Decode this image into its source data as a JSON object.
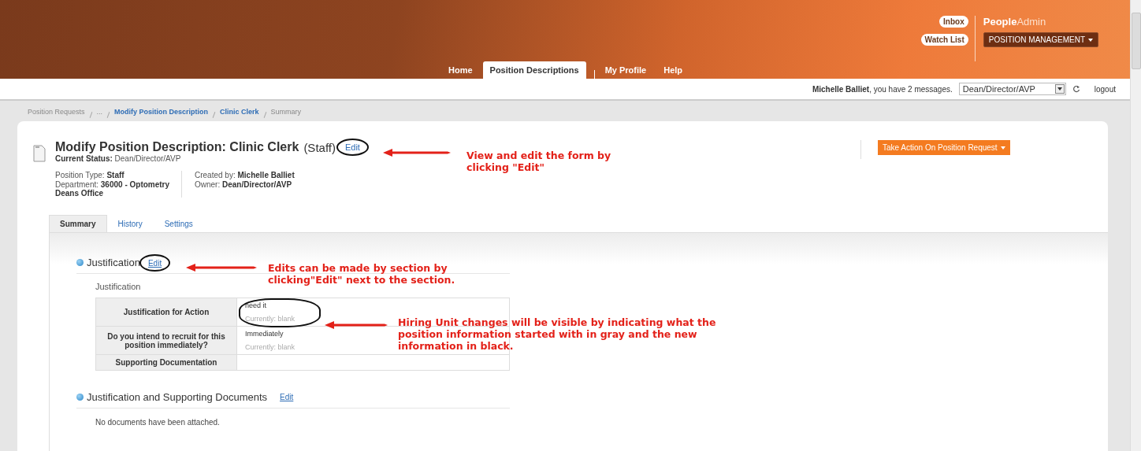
{
  "header": {
    "links": [
      "Inbox",
      "Watch List"
    ],
    "brand": {
      "bold": "People",
      "light": "Admin"
    },
    "module_menu": "POSITION MANAGEMENT",
    "nav": [
      {
        "label": "Home",
        "selected": false,
        "divider": false
      },
      {
        "label": "Position Descriptions",
        "selected": true,
        "divider": false
      },
      {
        "label": "My Profile",
        "selected": false,
        "divider": true
      },
      {
        "label": "Help",
        "selected": false,
        "divider": false
      }
    ]
  },
  "user_bar": {
    "user": "Michelle Balliet",
    "message": ", you have 2 messages.",
    "role": "Dean/Director/AVP",
    "logout": "logout"
  },
  "breadcrumb": [
    {
      "label": "Position Requests",
      "kind": "plain"
    },
    {
      "label": "...",
      "kind": "plain"
    },
    {
      "label": "Modify Position Description",
      "kind": "link"
    },
    {
      "label": "Clinic Clerk",
      "kind": "link"
    },
    {
      "label": "Summary",
      "kind": "plain"
    }
  ],
  "record": {
    "title": "Modify Position Description: Clinic Clerk",
    "type": "(Staff)",
    "edit": "Edit",
    "status_label": "Current Status:",
    "status": "Dean/Director/AVP",
    "meta_left": [
      {
        "label": "Position Type:",
        "value": "Staff"
      },
      {
        "label": "Department:",
        "value": "36000 - Optometry Deans Office"
      }
    ],
    "meta_right": [
      {
        "label": "Created by:",
        "value": "Michelle Balliet"
      },
      {
        "label": "Owner:",
        "value": "Dean/Director/AVP"
      }
    ],
    "action_button": "Take Action On Position Request"
  },
  "tabs": [
    {
      "label": "Summary",
      "selected": true
    },
    {
      "label": "History",
      "selected": false
    },
    {
      "label": "Settings",
      "selected": false
    }
  ],
  "sections": [
    {
      "title": "Justification",
      "edit": "Edit",
      "subtitle": "Justification",
      "rows": [
        {
          "label": "Justification for Action",
          "value": "need it",
          "current": "Currently: blank"
        },
        {
          "label": "Do you intend to recruit for this position immediately?",
          "value": "Immediately",
          "current": "Currently: blank"
        },
        {
          "label": "Supporting Documentation"
        }
      ]
    },
    {
      "title": "Justification and Supporting Documents",
      "edit": "Edit",
      "note": "No documents have been attached."
    }
  ],
  "annotations": [
    "View and edit the form by clicking \"Edit\"",
    "Edits can be made by section by clicking\"Edit\" next to the section.",
    "Hiring Unit changes will be visible by indicating what the position information started with in gray and the new information in black."
  ]
}
